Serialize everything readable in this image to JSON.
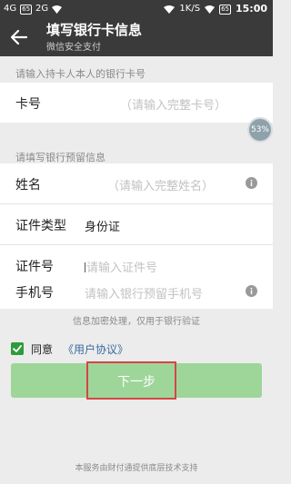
{
  "status_bar": {
    "left": [
      "4G",
      "65",
      "2G"
    ],
    "network_speed": "1K/S",
    "battery": "65",
    "time": "15:00"
  },
  "header": {
    "title": "填写银行卡信息",
    "subtitle": "微信安全支付"
  },
  "card_section": {
    "label": "请输入持卡人本人的银行卡号",
    "card_number": {
      "label": "卡号",
      "placeholder": "（请输入完整卡号）"
    }
  },
  "scroll_badge": "53%",
  "reserved_section": {
    "label": "请填写银行预留信息",
    "fields": [
      {
        "label": "姓名",
        "value": "（请输入完整姓名）",
        "has_info": true
      },
      {
        "label": "证件类型",
        "value": "身份证",
        "has_info": false
      },
      {
        "label": "证件号",
        "value": "请输入证件号",
        "has_info": false
      },
      {
        "label": "手机号",
        "value": "请输入银行预留手机号",
        "has_info": true
      }
    ]
  },
  "notice": "信息加密处理，仅用于银行验证",
  "agreement": {
    "checked": true,
    "text": "同意",
    "link": "《用户协议》"
  },
  "next_button": {
    "label": "下一步"
  },
  "footer": "本服务由财付通提供底层技术支持",
  "colors": {
    "appbar": "#3a3a3a",
    "accent_green": "#2e9c3c",
    "button_green": "#9ed69a",
    "highlight_red": "#d64545",
    "link_blue": "#3b6aa0"
  }
}
